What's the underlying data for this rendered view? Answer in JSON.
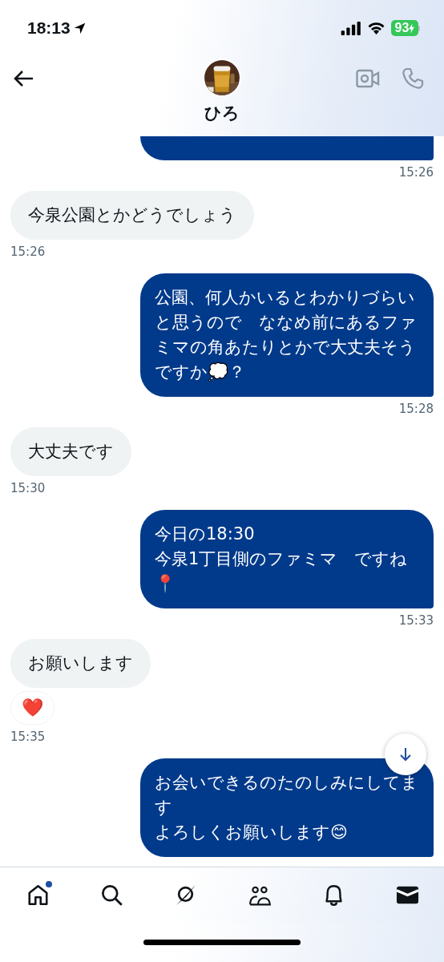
{
  "status_bar": {
    "time": "18:13",
    "battery": "93",
    "charging": true
  },
  "conversation": {
    "name": "ひろ"
  },
  "messages": [
    {
      "kind": "sent",
      "time": "15:26"
    },
    {
      "kind": "received",
      "lines": [
        "今泉公園とかどうでしょう"
      ],
      "time": "15:26"
    },
    {
      "kind": "sent",
      "lines": [
        "公園、何人かいるとわかりづらいと思うので　ななめ前にあるファミマの角あたりとかで大丈夫そうですか💭？"
      ],
      "time": "15:28"
    },
    {
      "kind": "received",
      "lines": [
        "大丈夫です"
      ],
      "time": "15:30"
    },
    {
      "kind": "sent",
      "lines": [
        "今日の18:30",
        "今泉1丁目側のファミマ　ですね",
        "📍"
      ],
      "time": "15:33"
    },
    {
      "kind": "received",
      "lines": [
        "お願いします"
      ],
      "reaction": "❤️",
      "time": "15:35"
    },
    {
      "kind": "sent",
      "lines": [
        "お会いできるのたのしみにしてます",
        "よろしくお願いします😊"
      ]
    }
  ],
  "nav": {
    "items": [
      {
        "selected": false,
        "dot": true
      },
      {
        "selected": false,
        "dot": false
      },
      {
        "selected": false,
        "dot": false
      },
      {
        "selected": false,
        "dot": false
      },
      {
        "selected": false,
        "dot": false
      },
      {
        "selected": true,
        "dot": false
      }
    ]
  }
}
